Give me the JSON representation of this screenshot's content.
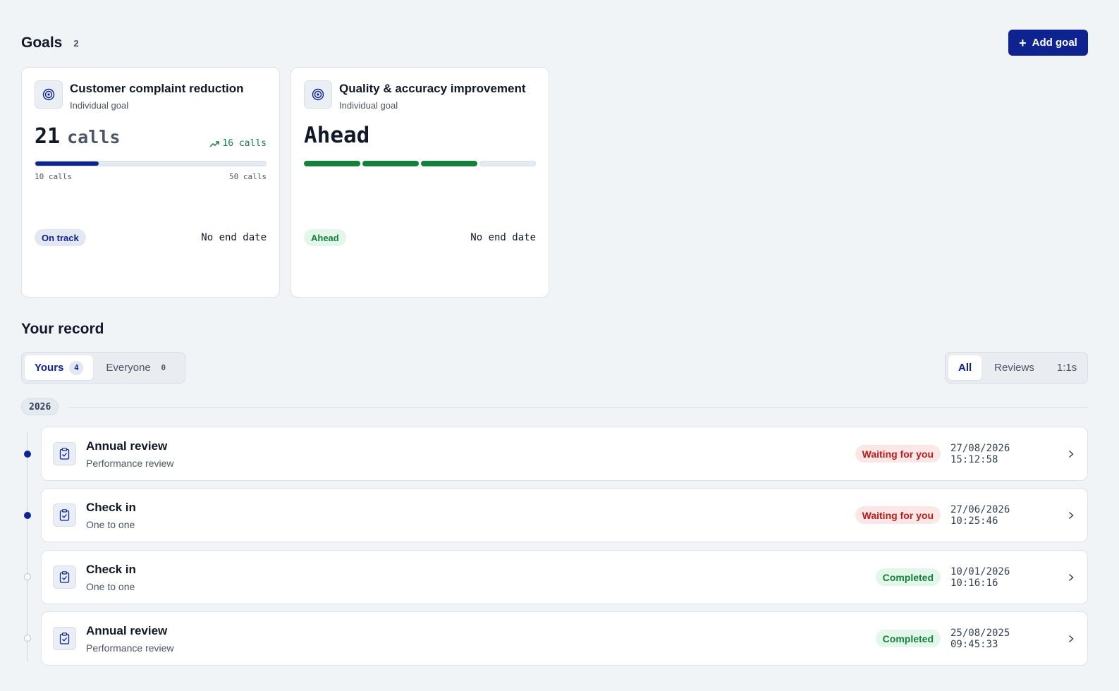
{
  "goals": {
    "title": "Goals",
    "count": "2",
    "add_button": "Add goal",
    "cards": [
      {
        "name": "Customer complaint reduction",
        "type": "Individual goal",
        "value": "21",
        "unit": "calls",
        "trend": "16 calls",
        "progress_percent": 27.5,
        "range_min": "10 calls",
        "range_max": "50 calls",
        "badge": "On track",
        "end_date": "No end date"
      },
      {
        "name": "Quality & accuracy improvement",
        "type": "Individual goal",
        "status_word": "Ahead",
        "segments_filled": 3,
        "segments_total": 4,
        "badge": "Ahead",
        "end_date": "No end date"
      }
    ]
  },
  "record": {
    "title": "Your record",
    "scope_tabs": [
      {
        "label": "Yours",
        "count": "4"
      },
      {
        "label": "Everyone",
        "count": "0"
      }
    ],
    "filter_tabs": [
      "All",
      "Reviews",
      "1:1s"
    ],
    "year": "2026",
    "items": [
      {
        "title": "Annual review",
        "subtitle": "Performance review",
        "status": "Waiting for you",
        "date": "27/08/2026 15:12:58"
      },
      {
        "title": "Check in",
        "subtitle": "One to one",
        "status": "Waiting for you",
        "date": "27/06/2026 10:25:46"
      },
      {
        "title": "Check in",
        "subtitle": "One to one",
        "status": "Completed",
        "date": "10/01/2026 10:16:16"
      },
      {
        "title": "Annual review",
        "subtitle": "Performance review",
        "status": "Completed",
        "date": "25/08/2025 09:45:33"
      }
    ]
  },
  "colors": {
    "accent": "#0f2390",
    "success": "#15803d",
    "danger": "#b91c1c",
    "background": "#f1f4f7"
  },
  "icons": [
    "plus-icon",
    "target-icon",
    "trend-up-icon",
    "clipboard-check-icon",
    "chevron-right-icon"
  ]
}
